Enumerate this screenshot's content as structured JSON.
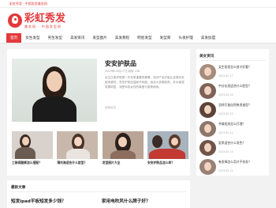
{
  "topbar": {
    "text": "彩虹秀发 · 中国发型美发网"
  },
  "header": {
    "title": "彩虹秀发",
    "subtitle": "美发网 · 中国发型网"
  },
  "nav": [
    "首页",
    "女生发型",
    "男生发型",
    "美发资讯",
    "发型图片",
    "美发教程",
    "明星发型",
    "发型库",
    "头发护理",
    "美发加盟"
  ],
  "hero": {
    "title": "安安护肤品",
    "meta": "2023年05月17日  阅读 236",
    "desc": "女生日常护肤是一件非常重要的事情，选对产品才能让皮肤状态越来越好。安安护肤品温和不刺激，适合大多数肤质，补水保湿效果明显，深受年轻女性的喜爱与推荐使用。",
    "more": "阅读全文"
  },
  "thumbs": [
    {
      "caption": "工装阔腿裤怎么搭配？"
    },
    {
      "caption": "薄刘海适合什么脸型？"
    },
    {
      "caption": "发型图片大全"
    },
    {
      "caption": "安安护肤品怎么样？"
    }
  ],
  "lower": {
    "heading": "最新文章",
    "left": "短发ipad平板短发多少钱？",
    "right": "家用电吹风什么牌子好？"
  },
  "side": {
    "heading": "美女资讯",
    "items": [
      {
        "title": "女生短发怎么剪才好看？",
        "date": "2023-05-17"
      },
      {
        "title": "中分长发适合什么脸型？",
        "date": "2023-05-16"
      },
      {
        "title": "怎样打造自然卷发造型？",
        "date": "2023-05-15"
      },
      {
        "title": "齐肩短发怎么打理？",
        "date": "2023-05-14"
      },
      {
        "title": "夏季适合什么发色？",
        "date": "2023-05-13"
      },
      {
        "title": "卷发棒怎么用才不伤发？",
        "date": "2023-05-12"
      }
    ]
  }
}
